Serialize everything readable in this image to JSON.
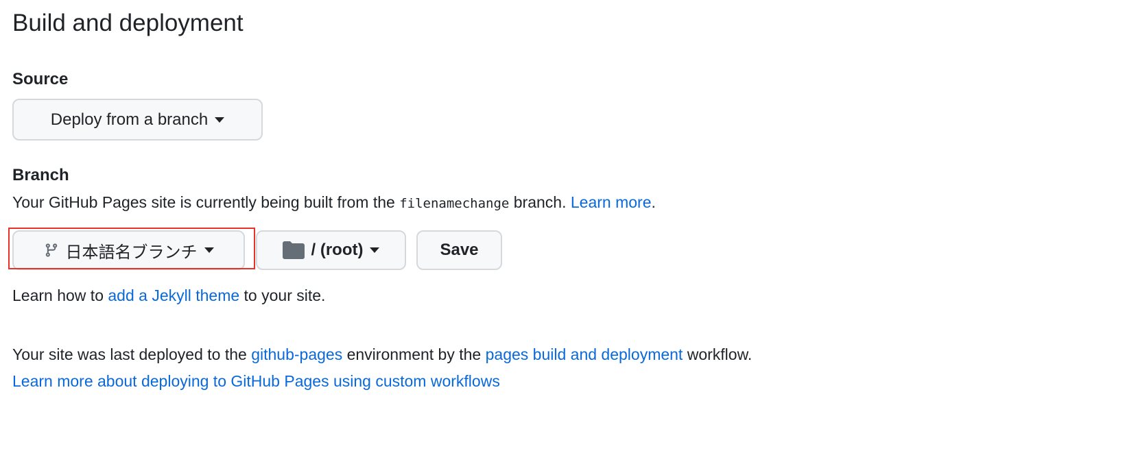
{
  "title": "Build and deployment",
  "source": {
    "label": "Source",
    "dropdown": "Deploy from a branch"
  },
  "branch": {
    "label": "Branch",
    "desc_pre": "Your GitHub Pages site is currently being built from the ",
    "branch_code": "filenamechange",
    "desc_post": " branch. ",
    "learn_more": "Learn more",
    "period": ".",
    "branch_button": "日本語名ブランチ",
    "folder_button": "/ (root)",
    "save": "Save"
  },
  "jekyll": {
    "pre": "Learn how to ",
    "link": "add a Jekyll theme",
    "post": " to your site."
  },
  "deploy": {
    "pre": "Your site was last deployed to the ",
    "env_link": "github-pages",
    "mid": " environment by the ",
    "workflow_link": "pages build and deployment",
    "post": " workflow.",
    "custom_link": "Learn more about deploying to GitHub Pages using custom workflows"
  },
  "colors": {
    "link": "#0969da",
    "highlight": "#e5332a"
  }
}
